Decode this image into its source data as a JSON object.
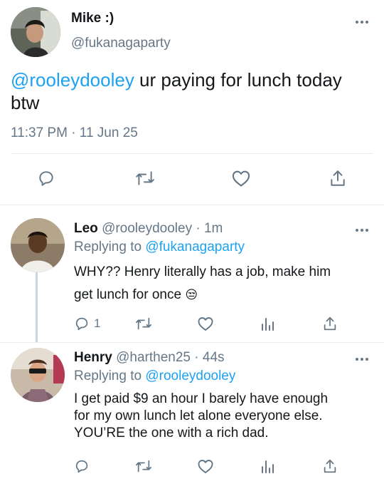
{
  "main_tweet": {
    "display_name": "Mike :)",
    "handle": "@fukanagaparty",
    "mention": "@rooleydooley",
    "text_line1": " ur paying for lunch today",
    "text_line2": "btw",
    "timestamp": "11:37 PM · 11 Jun 25"
  },
  "replies": [
    {
      "display_name": "Leo",
      "handle": "@rooleydooley",
      "time": "· 1m",
      "replying_prefix": "Replying to ",
      "replying_to": "@fukanagaparty",
      "text_line1": "WHY?? Henry literally has a job, make him",
      "text_line2": "get lunch for once",
      "emoji": "😒",
      "reply_count": "1"
    },
    {
      "display_name": "Henry",
      "handle": "@harthen25",
      "time": "· 44s",
      "replying_prefix": "Replying to ",
      "replying_to": "@rooleydooley",
      "text_line1": "I get paid $9 an hour I barely have enough",
      "text_line2": "for my own lunch let alone everyone else.",
      "text_line3": "YOU’RE the one with a rich dad."
    }
  ],
  "colors": {
    "link": "#1da1f2",
    "muted": "#657786",
    "text": "#14171a",
    "divider": "#e6ecf0"
  },
  "icons": [
    "reply-icon",
    "retweet-icon",
    "like-icon",
    "share-icon",
    "analytics-icon",
    "more-options-icon"
  ]
}
